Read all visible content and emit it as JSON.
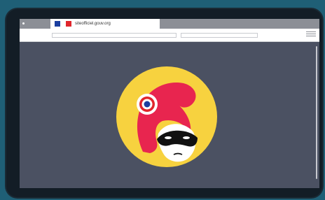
{
  "browser": {
    "tab_title": "siteofficiel.gouv.org",
    "colors": {
      "flag_blue": "#1c3fa0",
      "flag_red": "#e0262c",
      "page_background": "#4b5162",
      "circle_yellow": "#f7d23f",
      "bonnet_red": "#e8254f"
    },
    "icons": [
      "menu-icon"
    ]
  },
  "content": {
    "emblem": "masked-marianne-logo"
  }
}
